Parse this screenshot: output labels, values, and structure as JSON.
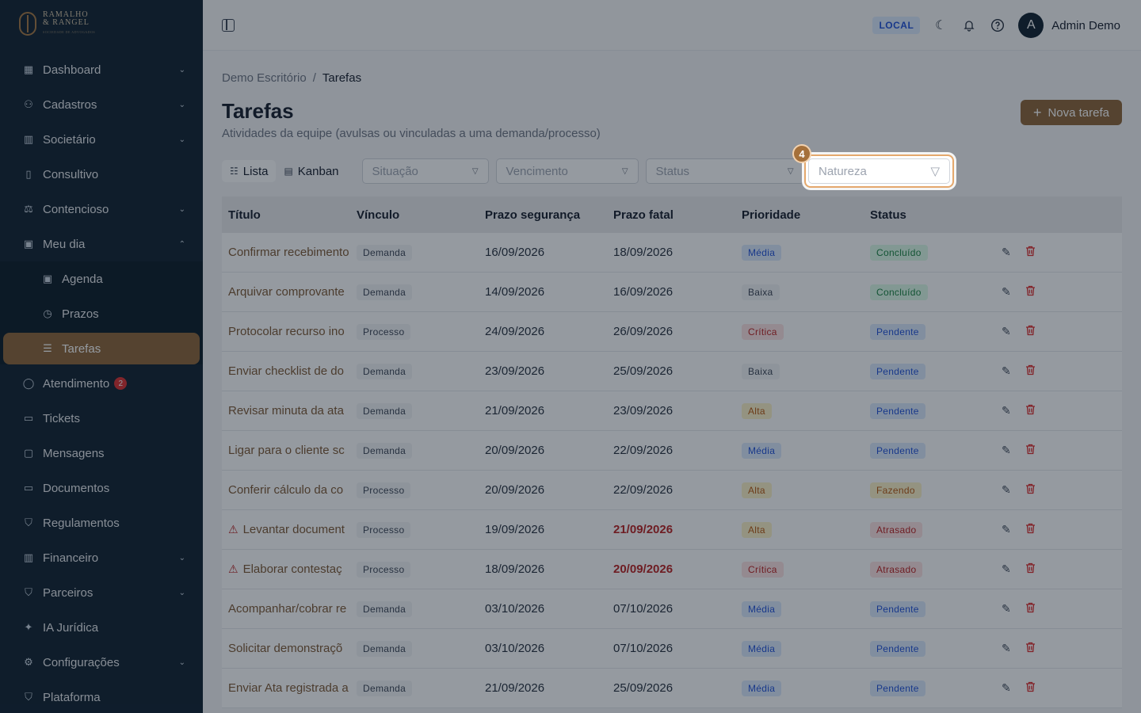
{
  "brand": {
    "name_line1": "RAMALHO",
    "name_line2": "& RANGEL",
    "tagline": "SOCIEDADE DE ADVOGADOS"
  },
  "sidebar": {
    "items": [
      {
        "label": "Dashboard",
        "icon": "dashboard-icon",
        "expandable": true
      },
      {
        "label": "Cadastros",
        "icon": "cadastros-icon",
        "expandable": true
      },
      {
        "label": "Societário",
        "icon": "building-icon",
        "expandable": true
      },
      {
        "label": "Consultivo",
        "icon": "book-icon",
        "expandable": false
      },
      {
        "label": "Contencioso",
        "icon": "scale-icon",
        "expandable": true
      },
      {
        "label": "Meu dia",
        "icon": "calendar-icon",
        "expandable": true,
        "expanded": true
      }
    ],
    "sub_items": [
      {
        "label": "Agenda",
        "icon": "calendar-icon"
      },
      {
        "label": "Prazos",
        "icon": "clock-calendar-icon"
      },
      {
        "label": "Tarefas",
        "icon": "checklist-icon",
        "active": true
      }
    ],
    "items_after": [
      {
        "label": "Atendimento",
        "icon": "chat-icon",
        "badge": "2"
      },
      {
        "label": "Tickets",
        "icon": "ticket-icon"
      },
      {
        "label": "Mensagens",
        "icon": "message-icon"
      },
      {
        "label": "Documentos",
        "icon": "folder-icon"
      },
      {
        "label": "Regulamentos",
        "icon": "shield-icon"
      },
      {
        "label": "Financeiro",
        "icon": "bank-icon",
        "expandable": true
      },
      {
        "label": "Parceiros",
        "icon": "handshake-icon",
        "expandable": true
      },
      {
        "label": "IA Jurídica",
        "icon": "sparkle-icon"
      },
      {
        "label": "Configurações",
        "icon": "gear-icon",
        "expandable": true
      },
      {
        "label": "Plataforma",
        "icon": "shield-icon"
      }
    ]
  },
  "topbar": {
    "env": "LOCAL",
    "avatar_letter": "A",
    "user_name": "Admin Demo"
  },
  "breadcrumb": {
    "root": "Demo Escritório",
    "separator": "/",
    "current": "Tarefas"
  },
  "page": {
    "title": "Tarefas",
    "subtitle": "Atividades da equipe (avulsas ou vinculadas a uma demanda/processo)",
    "new_button": "Nova tarefa"
  },
  "filters": {
    "views": [
      {
        "label": "Lista",
        "selected": true
      },
      {
        "label": "Kanban",
        "selected": false
      }
    ],
    "situacao": "Situação",
    "vencimento": "Vencimento",
    "status": "Status",
    "natureza": "Natureza"
  },
  "tour": {
    "step": "4"
  },
  "table": {
    "headers": [
      "Título",
      "Vínculo",
      "Prazo segurança",
      "Prazo fatal",
      "Prioridade",
      "Status"
    ],
    "rows": [
      {
        "title": "Confirmar recebimento",
        "warn": false,
        "vinculo": "Demanda",
        "prazo_seg": "16/09/2026",
        "prazo_fatal": "18/09/2026",
        "overdue": false,
        "prioridade": "Média",
        "status": "Concluído"
      },
      {
        "title": "Arquivar comprovante",
        "warn": false,
        "vinculo": "Demanda",
        "prazo_seg": "14/09/2026",
        "prazo_fatal": "16/09/2026",
        "overdue": false,
        "prioridade": "Baixa",
        "status": "Concluído"
      },
      {
        "title": "Protocolar recurso ino",
        "warn": false,
        "vinculo": "Processo",
        "prazo_seg": "24/09/2026",
        "prazo_fatal": "26/09/2026",
        "overdue": false,
        "prioridade": "Crítica",
        "status": "Pendente"
      },
      {
        "title": "Enviar checklist de do",
        "warn": false,
        "vinculo": "Demanda",
        "prazo_seg": "23/09/2026",
        "prazo_fatal": "25/09/2026",
        "overdue": false,
        "prioridade": "Baixa",
        "status": "Pendente"
      },
      {
        "title": "Revisar minuta da ata",
        "warn": false,
        "vinculo": "Demanda",
        "prazo_seg": "21/09/2026",
        "prazo_fatal": "23/09/2026",
        "overdue": false,
        "prioridade": "Alta",
        "status": "Pendente"
      },
      {
        "title": "Ligar para o cliente sc",
        "warn": false,
        "vinculo": "Demanda",
        "prazo_seg": "20/09/2026",
        "prazo_fatal": "22/09/2026",
        "overdue": false,
        "prioridade": "Média",
        "status": "Pendente"
      },
      {
        "title": "Conferir cálculo da co",
        "warn": false,
        "vinculo": "Processo",
        "prazo_seg": "20/09/2026",
        "prazo_fatal": "22/09/2026",
        "overdue": false,
        "prioridade": "Alta",
        "status": "Fazendo"
      },
      {
        "title": "Levantar document",
        "warn": true,
        "vinculo": "Processo",
        "prazo_seg": "19/09/2026",
        "prazo_fatal": "21/09/2026",
        "overdue": true,
        "prioridade": "Alta",
        "status": "Atrasado"
      },
      {
        "title": "Elaborar contestaç",
        "warn": true,
        "vinculo": "Processo",
        "prazo_seg": "18/09/2026",
        "prazo_fatal": "20/09/2026",
        "overdue": true,
        "prioridade": "Crítica",
        "status": "Atrasado"
      },
      {
        "title": "Acompanhar/cobrar re",
        "warn": false,
        "vinculo": "Demanda",
        "prazo_seg": "03/10/2026",
        "prazo_fatal": "07/10/2026",
        "overdue": false,
        "prioridade": "Média",
        "status": "Pendente"
      },
      {
        "title": "Solicitar demonstraçõ",
        "warn": false,
        "vinculo": "Demanda",
        "prazo_seg": "03/10/2026",
        "prazo_fatal": "07/10/2026",
        "overdue": false,
        "prioridade": "Média",
        "status": "Pendente"
      },
      {
        "title": "Enviar Ata registrada a",
        "warn": false,
        "vinculo": "Demanda",
        "prazo_seg": "21/09/2026",
        "prazo_fatal": "25/09/2026",
        "overdue": false,
        "prioridade": "Média",
        "status": "Pendente"
      }
    ]
  },
  "colors": {
    "sidebar_bg": "#0b1d2b",
    "accent": "#8a6234",
    "priority": {
      "Média": [
        "#dbeafe",
        "#1d4ed8"
      ],
      "Baixa": [
        "#f3f4f6",
        "#374151"
      ],
      "Crítica": [
        "#fee2e2",
        "#b91c1c"
      ],
      "Alta": [
        "#fef3c7",
        "#b45309"
      ]
    },
    "status": {
      "Concluído": [
        "#dcfce7",
        "#15803d"
      ],
      "Pendente": [
        "#dbeafe",
        "#1d4ed8"
      ],
      "Fazendo": [
        "#fef3c7",
        "#b45309"
      ],
      "Atrasado": [
        "#fee2e2",
        "#b91c1c"
      ]
    }
  }
}
